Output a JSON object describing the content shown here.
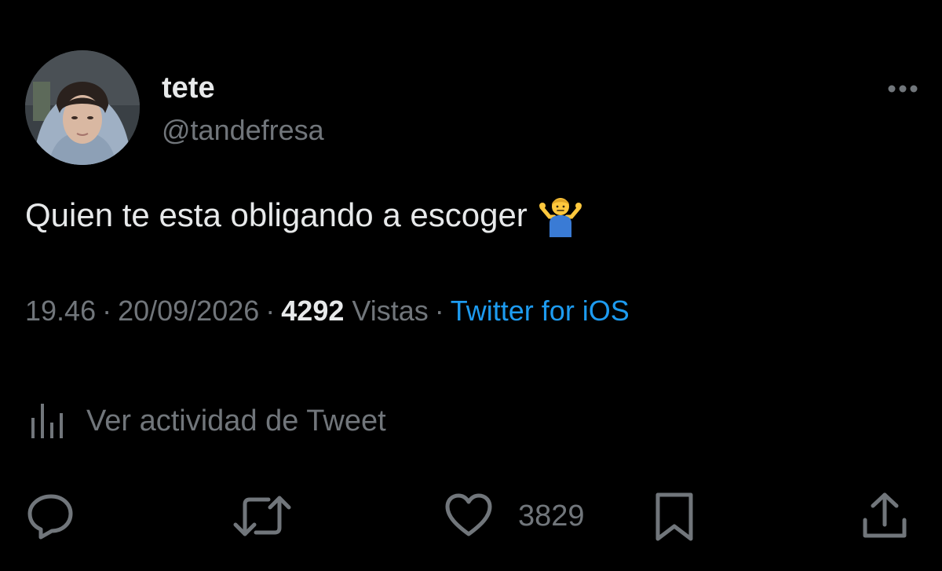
{
  "user": {
    "display_name": "tete",
    "handle": "@tandefresa"
  },
  "tweet": {
    "text": "Quien te esta obligando a escoger",
    "emoji_name": "person-shrugging-icon"
  },
  "meta": {
    "time": "19.46",
    "date": "20/09/2026",
    "views_count": "4292",
    "views_label": "Vistas",
    "source": "Twitter for iOS",
    "separator": "·"
  },
  "activity": {
    "label": "Ver actividad de Tweet",
    "icon": "analytics-icon"
  },
  "actions": {
    "reply_icon": "reply-icon",
    "retweet_icon": "retweet-icon",
    "like_icon": "heart-icon",
    "like_count": "3829",
    "bookmark_icon": "bookmark-icon",
    "share_icon": "share-icon"
  },
  "colors": {
    "background": "#000000",
    "text_primary": "#e7e9ea",
    "text_secondary": "#71767b",
    "link": "#1d9bf0"
  }
}
